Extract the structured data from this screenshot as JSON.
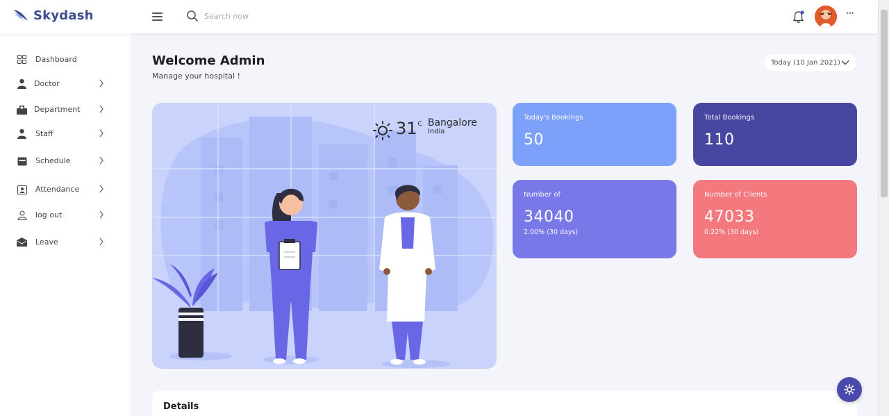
{
  "brand": {
    "name": "Skydash",
    "color": "#3b4d8f"
  },
  "search": {
    "placeholder": "Search now"
  },
  "header": {
    "more": "•••"
  },
  "sidebar": {
    "items": [
      {
        "label": "Dashboard",
        "icon": "grid-icon"
      },
      {
        "label": "Doctor",
        "icon": "user-doctor-icon"
      },
      {
        "label": "Department",
        "icon": "hospital-icon"
      },
      {
        "label": "Staff",
        "icon": "user-icon"
      },
      {
        "label": "Schedule",
        "icon": "calendar-icon"
      },
      {
        "label": "Attendance",
        "icon": "attendance-icon"
      },
      {
        "label": "log out",
        "icon": "user-outline-icon"
      },
      {
        "label": "Leave",
        "icon": "envelope-icon"
      }
    ]
  },
  "welcome": {
    "title": "Welcome Admin",
    "subtitle": "Manage your hospital !"
  },
  "date_filter": {
    "label": "Today (10 Jan 2021)"
  },
  "weather": {
    "temp": "31",
    "unit": "C",
    "city": "Bangalore",
    "country": "India"
  },
  "cards": {
    "today": {
      "title": "Today's Bookings",
      "value": "50",
      "color": "#7da0fa"
    },
    "total": {
      "title": "Total Bookings",
      "value": "110",
      "color": "#4747a1"
    },
    "number": {
      "title": "Number of",
      "value": "34040",
      "sub": "2.00% (30 days)",
      "color": "#7978e9"
    },
    "clients": {
      "title": "Number of Clients",
      "value": "47033",
      "sub": "0.22% (30 days)",
      "color": "#f3797e"
    }
  },
  "details": {
    "title": "Details"
  },
  "colors": {
    "accent": "#4b49ac",
    "background": "#f4f5fb",
    "hero_bg": "#c9d3fb"
  }
}
